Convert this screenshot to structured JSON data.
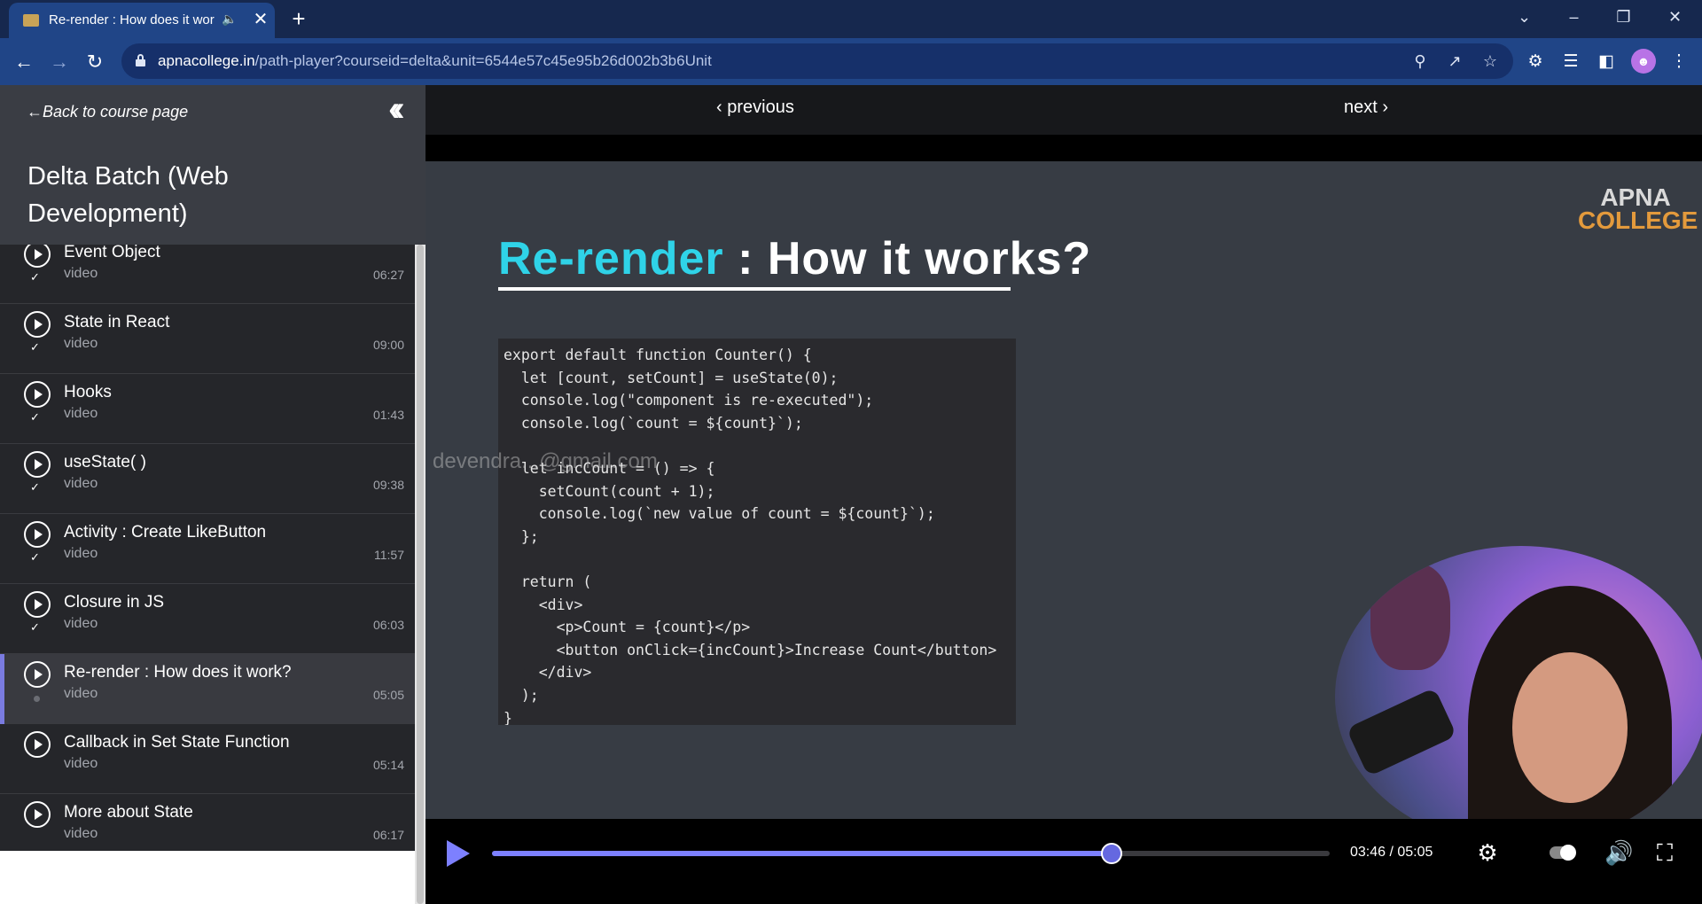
{
  "browser": {
    "tab_title": "Re-render : How does it wor",
    "url_host": "apnacollege.in",
    "url_path": "/path-player?courseid=delta&unit=6544e57c45e95b26d002b3b6Unit"
  },
  "sidebar": {
    "back_label": "Back to course page",
    "course_title": "Delta Batch (Web Development)",
    "lessons": [
      {
        "title": "Event Object",
        "type": "video",
        "duration": "06:27",
        "completed": true
      },
      {
        "title": "State in React",
        "type": "video",
        "duration": "09:00",
        "completed": true
      },
      {
        "title": "Hooks",
        "type": "video",
        "duration": "01:43",
        "completed": true
      },
      {
        "title": "useState( )",
        "type": "video",
        "duration": "09:38",
        "completed": true
      },
      {
        "title": "Activity : Create LikeButton",
        "type": "video",
        "duration": "11:57",
        "completed": true
      },
      {
        "title": "Closure in JS",
        "type": "video",
        "duration": "06:03",
        "completed": true
      },
      {
        "title": "Re-render : How does it work?",
        "type": "video",
        "duration": "05:05",
        "completed": false,
        "active": true
      },
      {
        "title": "Callback in Set State Function",
        "type": "video",
        "duration": "05:14",
        "completed": false
      },
      {
        "title": "More about State",
        "type": "video",
        "duration": "06:17",
        "completed": false
      }
    ]
  },
  "nav": {
    "previous_label": "previous",
    "next_label": "next"
  },
  "slide": {
    "logo_line1": "APNA",
    "logo_line2": "COLLEGE",
    "heading_highlight": "Re-render",
    "heading_rest": " : How it works?",
    "code_lines": [
      "export default function Counter() {",
      "  let [count, setCount] = useState(0);",
      "  console.log(\"component is re-executed\");",
      "  console.log(`count = ${count}`);",
      "",
      "  let incCount = () => {",
      "    setCount(count + 1);",
      "    console.log(`new value of count = ${count}`);",
      "  };",
      "",
      "  return (",
      "    <div>",
      "      <p>Count = {count}</p>",
      "      <button onClick={incCount}>Increase Count</button>",
      "    </div>",
      "  );",
      "}"
    ],
    "watermark": "devendra...@gmail.com"
  },
  "player": {
    "current_time": "03:46",
    "duration": "05:05",
    "time_label": "03:46 / 05:05",
    "progress_fraction": 0.74,
    "accent_color": "#7d80ff"
  },
  "icons": {
    "settings": "gear-icon",
    "volume": "volume-icon",
    "fullscreen": "fullscreen-icon"
  }
}
